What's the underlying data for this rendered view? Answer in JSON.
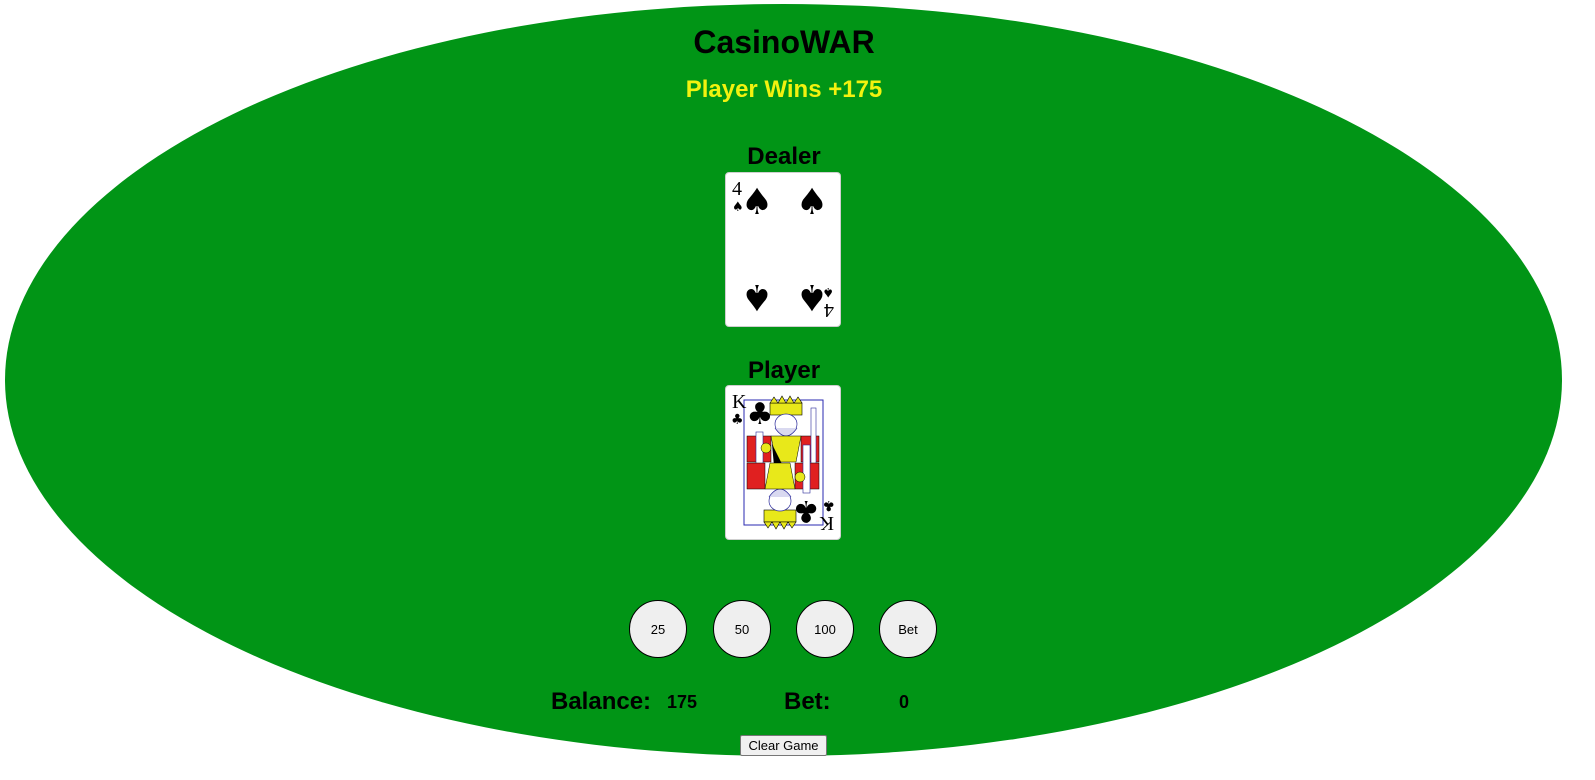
{
  "header": {
    "title": "CasinoWAR",
    "result_message": "Player Wins +175"
  },
  "dealer": {
    "label": "Dealer",
    "card": {
      "rank": "4",
      "suit": "spades",
      "suit_glyph": "♠",
      "color": "#000000"
    }
  },
  "player": {
    "label": "Player",
    "card": {
      "rank": "K",
      "suit": "clubs",
      "suit_glyph": "♣",
      "color": "#000000"
    }
  },
  "chips": [
    {
      "label": "25"
    },
    {
      "label": "50"
    },
    {
      "label": "100"
    },
    {
      "label": "Bet"
    }
  ],
  "stats": {
    "balance_label": "Balance:",
    "balance_value": "175",
    "bet_label": "Bet:",
    "bet_value": "0"
  },
  "controls": {
    "clear_label": "Clear Game"
  },
  "colors": {
    "table_felt": "#019516",
    "result_text": "#f2f20f"
  }
}
